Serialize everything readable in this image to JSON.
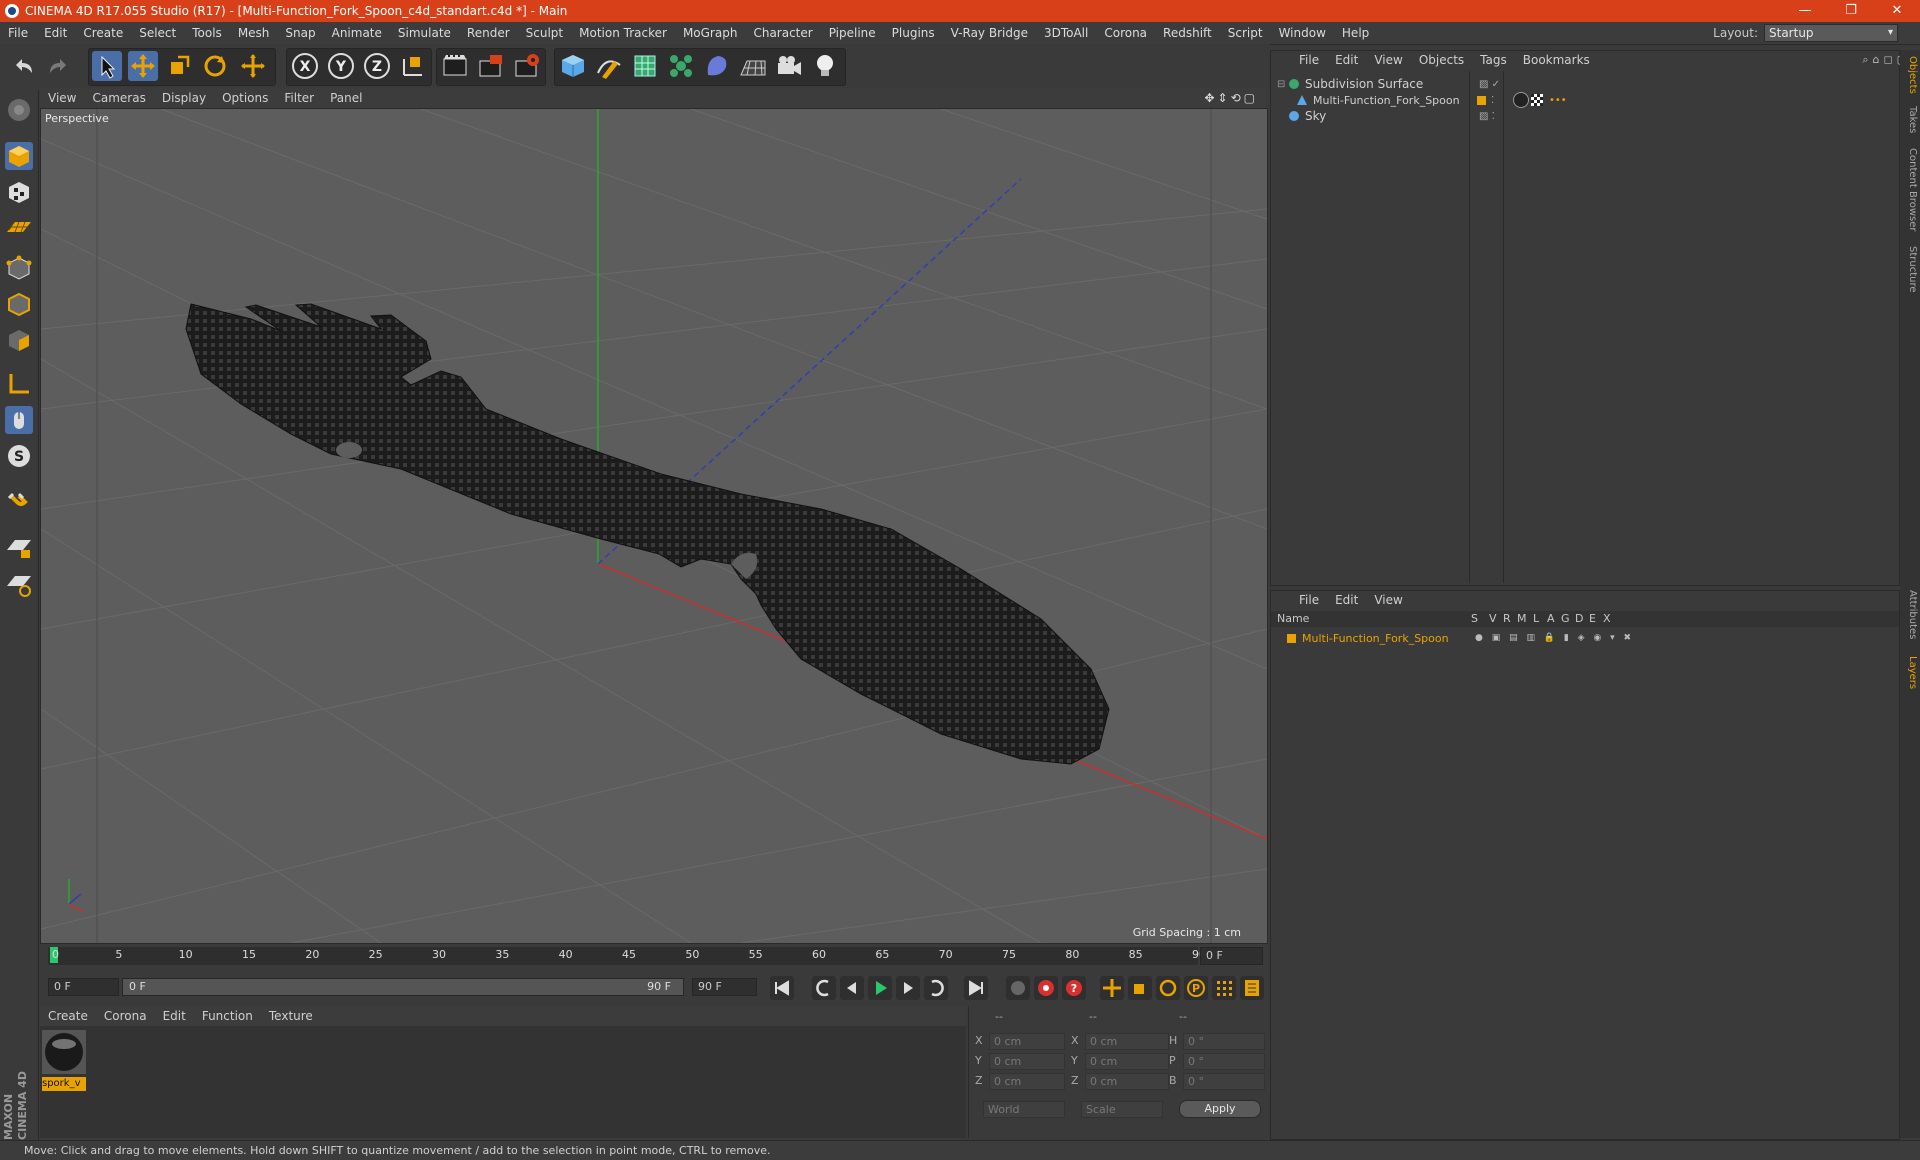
{
  "window": {
    "title": "CINEMA 4D R17.055 Studio (R17) - [Multi-Function_Fork_Spoon_c4d_standart.c4d *] - Main"
  },
  "menu": [
    "File",
    "Edit",
    "Create",
    "Select",
    "Tools",
    "Mesh",
    "Snap",
    "Animate",
    "Simulate",
    "Render",
    "Sculpt",
    "Motion Tracker",
    "MoGraph",
    "Character",
    "Pipeline",
    "Plugins",
    "V-Ray Bridge",
    "3DToAll",
    "Corona",
    "Redshift",
    "Script",
    "Window",
    "Help"
  ],
  "layout": {
    "label": "Layout:",
    "value": "Startup"
  },
  "viewport": {
    "menu": [
      "View",
      "Cameras",
      "Display",
      "Options",
      "Filter",
      "Panel"
    ],
    "label": "Perspective",
    "grid_spacing": "Grid Spacing : 1 cm"
  },
  "timeline": {
    "ticks": [
      "0",
      "5",
      "10",
      "15",
      "20",
      "25",
      "30",
      "35",
      "40",
      "45",
      "50",
      "55",
      "60",
      "65",
      "70",
      "75",
      "80",
      "85",
      "90"
    ],
    "current_frame": "0 F",
    "start_field": "0 F",
    "range_start": "0 F",
    "range_end": "90 F",
    "end_field": "90 F"
  },
  "materials": {
    "menu": [
      "Create",
      "Corona",
      "Edit",
      "Function",
      "Texture"
    ],
    "items": [
      {
        "name": "spork_v"
      }
    ]
  },
  "coords": {
    "headers": [
      "--",
      "--",
      "--"
    ],
    "rows": [
      {
        "l1": "X",
        "v1": "0 cm",
        "l2": "X",
        "v2": "0 cm",
        "l3": "H",
        "v3": "0 °"
      },
      {
        "l1": "Y",
        "v1": "0 cm",
        "l2": "Y",
        "v2": "0 cm",
        "l3": "P",
        "v3": "0 °"
      },
      {
        "l1": "Z",
        "v1": "0 cm",
        "l2": "Z",
        "v2": "0 cm",
        "l3": "B",
        "v3": "0 °"
      }
    ],
    "world": "World",
    "scale": "Scale",
    "apply": "Apply"
  },
  "objects": {
    "menu": [
      "File",
      "Edit",
      "View",
      "Objects",
      "Tags",
      "Bookmarks"
    ],
    "items": [
      {
        "name": "Subdivision Surface"
      },
      {
        "name": "Multi-Function_Fork_Spoon"
      },
      {
        "name": "Sky"
      }
    ]
  },
  "layers": {
    "menu": [
      "File",
      "Edit",
      "View"
    ],
    "columns": {
      "name": "Name",
      "flags": [
        "S",
        "V",
        "R",
        "M",
        "L",
        "A",
        "G",
        "D",
        "E",
        "X"
      ]
    },
    "items": [
      {
        "name": "Multi-Function_Fork_Spoon",
        "color": "#e8a300"
      }
    ]
  },
  "right_tabs": [
    "Objects",
    "Takes",
    "Content Browser",
    "Structure",
    "Attributes",
    "Layers"
  ],
  "status": "Move: Click and drag to move elements. Hold down SHIFT to quantize movement / add to the selection in point mode, CTRL to remove.",
  "colors": {
    "accent": "#d8401a",
    "selection": "#e8a300",
    "tool_blue": "#4a8ad8"
  }
}
